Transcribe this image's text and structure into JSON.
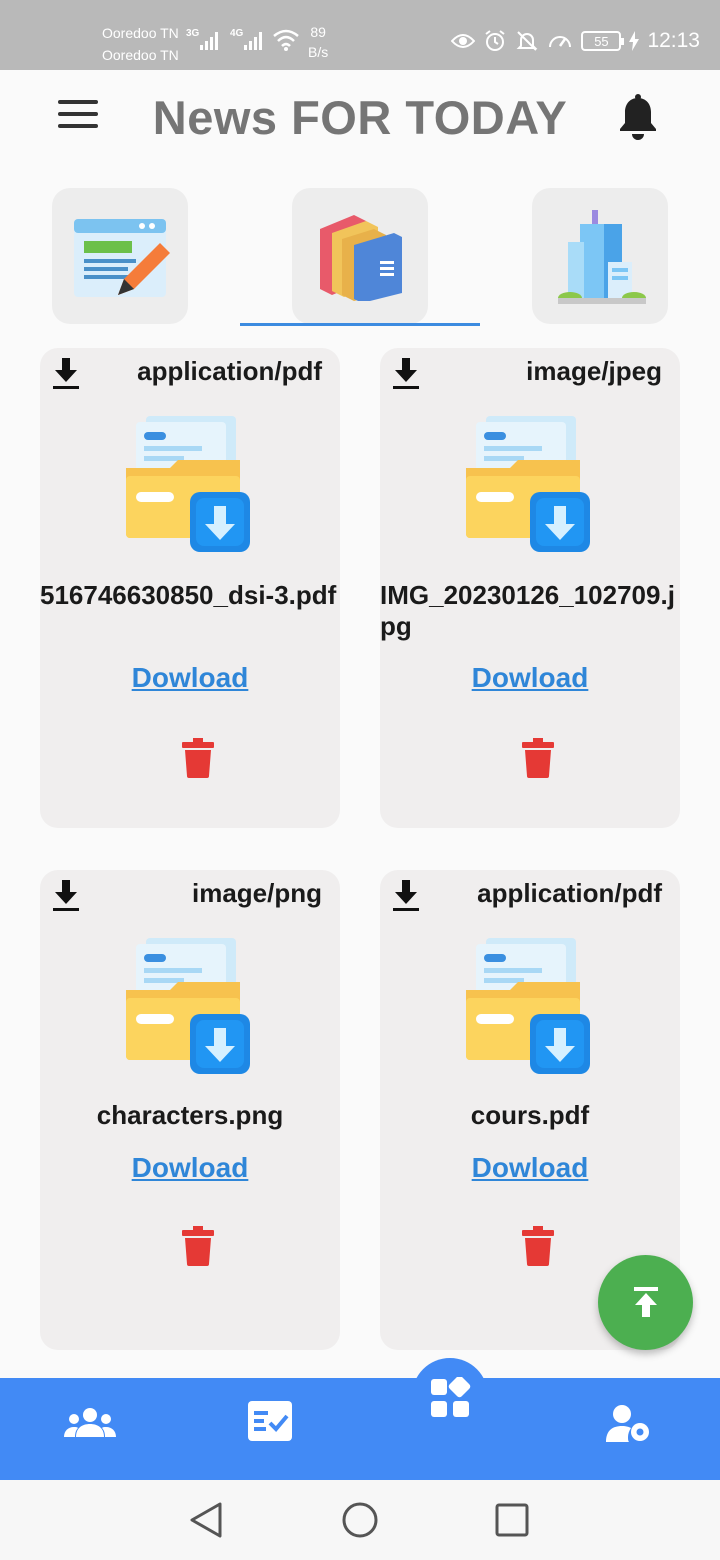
{
  "status_bar": {
    "carrier_1": "Ooredoo TN",
    "carrier_2": "Ooredoo TN",
    "net_1": "3G",
    "net_2": "4G",
    "speed_value": "89",
    "speed_unit": "B/s",
    "battery": "55",
    "time": "12:13"
  },
  "app_bar": {
    "title": "News FOR TODAY",
    "menu_icon": "hamburger-menu-icon",
    "notification_icon": "bell-icon"
  },
  "categories": [
    {
      "icon": "web-article-edit-icon",
      "selected": false
    },
    {
      "icon": "folders-stack-icon",
      "selected": true
    },
    {
      "icon": "office-building-icon",
      "selected": false
    }
  ],
  "files": [
    {
      "mime": "application/pdf",
      "name": "516746630850_dsi-3.pdf",
      "link": "Dowload"
    },
    {
      "mime": "image/jpeg",
      "name": "IMG_20230126_102709.jpg",
      "link": "Dowload"
    },
    {
      "mime": "image/png",
      "name": "characters.png",
      "link": "Dowload"
    },
    {
      "mime": "application/pdf",
      "name": "cours.pdf",
      "link": "Dowload"
    }
  ],
  "fab": {
    "icon": "scroll-to-top-icon"
  },
  "bottom_nav": {
    "items": [
      "users-group-icon",
      "task-list-icon",
      "dashboard-widgets-icon",
      "user-settings-icon"
    ],
    "active": "dashboard-widgets-icon",
    "color": "#428af5"
  },
  "colors": {
    "accent": "#3c8be0",
    "link": "#2f86d8",
    "delete": "#e53935",
    "fab": "#4caf50"
  }
}
